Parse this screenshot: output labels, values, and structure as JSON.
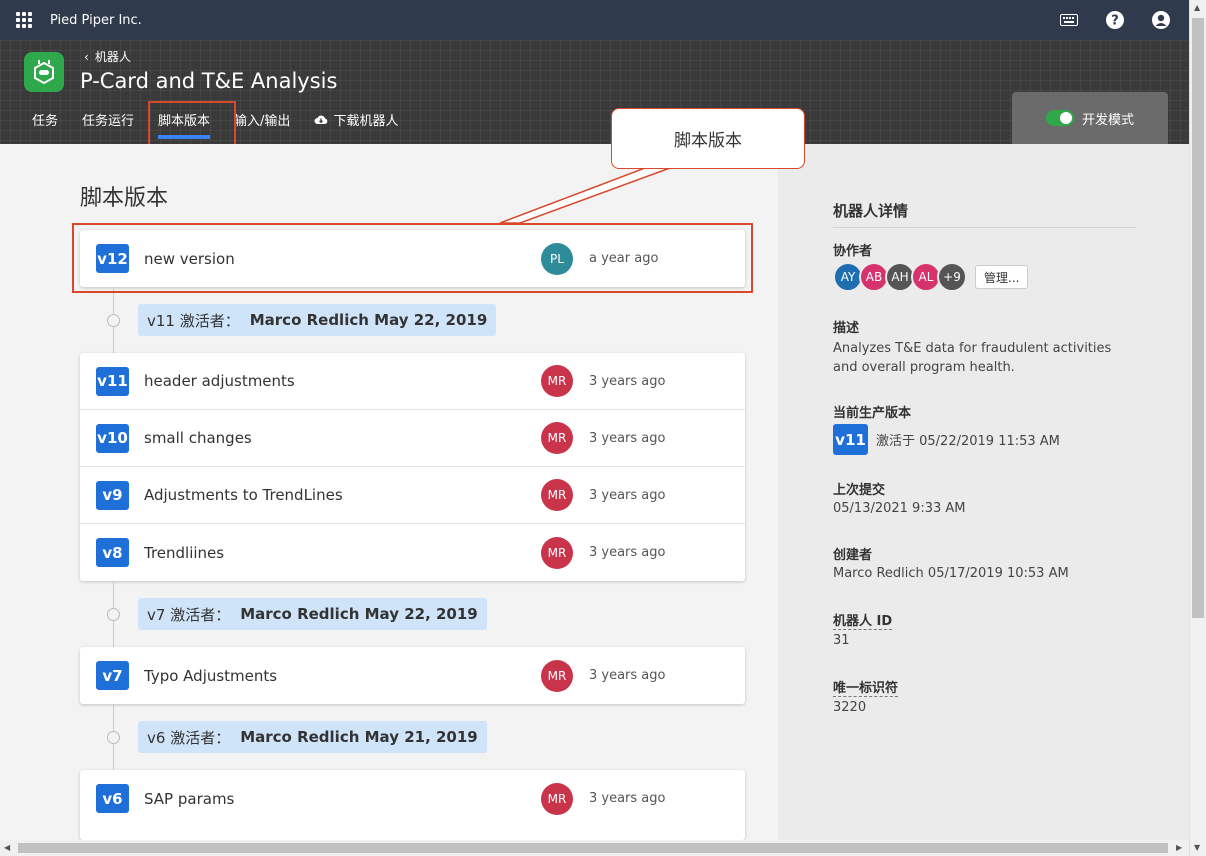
{
  "topbar": {
    "org_name": "Pied Piper Inc."
  },
  "header": {
    "breadcrumb": "机器人",
    "title": "P-Card and T&E Analysis",
    "tabs": [
      "任务",
      "任务运行",
      "脚本版本",
      "输入/输出",
      "下载机器人"
    ],
    "dev_mode_label": "开发模式"
  },
  "callout": {
    "text": "脚本版本"
  },
  "main": {
    "section_title": "脚本版本",
    "versions": [
      {
        "badge": "v12",
        "message": "new version",
        "author": "PL",
        "author_color": "#2e8b9a",
        "time": "a year ago"
      },
      {
        "badge": "v11",
        "message": "header adjustments",
        "author": "MR",
        "author_color": "#c9344a",
        "time": "3 years ago"
      },
      {
        "badge": "v10",
        "message": "small changes",
        "author": "MR",
        "author_color": "#c9344a",
        "time": "3 years ago"
      },
      {
        "badge": "v9",
        "message": "Adjustments to TrendLines",
        "author": "MR",
        "author_color": "#c9344a",
        "time": "3 years ago"
      },
      {
        "badge": "v8",
        "message": "Trendliines",
        "author": "MR",
        "author_color": "#c9344a",
        "time": "3 years ago"
      },
      {
        "badge": "v7",
        "message": "Typo Adjustments",
        "author": "MR",
        "author_color": "#c9344a",
        "time": "3 years ago"
      },
      {
        "badge": "v6",
        "message": "SAP params",
        "author": "MR",
        "author_color": "#c9344a",
        "time": "3 years ago"
      }
    ],
    "activations": [
      {
        "prefix": "v11 激活者：",
        "detail": "Marco Redlich May 22, 2019"
      },
      {
        "prefix": "v7 激活者：",
        "detail": "Marco Redlich May 22, 2019"
      },
      {
        "prefix": "v6 激活者：",
        "detail": "Marco Redlich May 21, 2019"
      }
    ]
  },
  "sidebar": {
    "title": "机器人详情",
    "collaborators_label": "协作者",
    "collaborators": [
      {
        "initials": "AY",
        "color": "#1f6fb0"
      },
      {
        "initials": "AB",
        "color": "#d6336c"
      },
      {
        "initials": "AH",
        "color": "#555555"
      },
      {
        "initials": "AL",
        "color": "#d6336c"
      },
      {
        "initials": "+9",
        "color": "#555555"
      }
    ],
    "manage_label": "管理...",
    "description_label": "描述",
    "description": "Analyzes T&E data for fraudulent activities and overall program health.",
    "prod_version_label": "当前生产版本",
    "prod_version_badge": "v11",
    "prod_version_text": "激活于 05/22/2019 11:53 AM",
    "last_commit_label": "上次提交",
    "last_commit": "05/13/2021 9:33 AM",
    "creator_label": "创建者",
    "creator": "Marco Redlich 05/17/2019 10:53 AM",
    "bot_id_label": "机器人 ID",
    "bot_id": "31",
    "uid_label": "唯一标识符",
    "uid": "3220"
  },
  "colors": {
    "accent": "#1f6fd8",
    "highlight": "#d9482b",
    "brand_green": "#2ea84a"
  }
}
